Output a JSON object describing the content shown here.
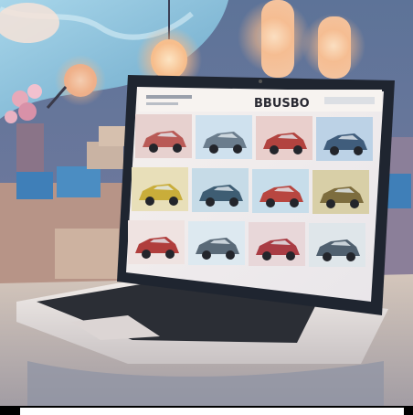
{
  "scene": {
    "description_label": "",
    "screen_header_text": "BBUSBO",
    "car_grid": {
      "rows": 4,
      "cols": 4,
      "cars": [
        {
          "color": "#b95a56",
          "bg": "#e7d1cf"
        },
        {
          "color": "#6b7d8d",
          "bg": "#cfe1ee"
        },
        {
          "color": "#b2433f",
          "bg": "#e9cfcc"
        },
        {
          "color": "#405d7c",
          "bg": "#bcd2e6"
        },
        {
          "color": "#c9ad3a",
          "bg": "#e8dfb9"
        },
        {
          "color": "#3e5d73",
          "bg": "#c6dbe7"
        },
        {
          "color": "#b84640",
          "bg": "#c7ddea"
        },
        {
          "color": "#7d6d3e",
          "bg": "#d8cfa7"
        },
        {
          "color": "#b03e3c",
          "bg": "#efe3e1"
        },
        {
          "color": "#5a6a78",
          "bg": "#dde9f0"
        },
        {
          "color": "#a93c44",
          "bg": "#e8d7d9"
        },
        {
          "color": "#50606f",
          "bg": "#dfe6ea"
        }
      ]
    },
    "colors": {
      "wall": "#6a7ea0",
      "sky": "#8fc2dc",
      "lamp_glow": "#f5b98c",
      "desk": "#d8c8b8",
      "laptop_body": "#e9e4e2",
      "bezel": "#1f2530",
      "keyboard": "#2b2e35",
      "bottom_bar": "#000000"
    }
  }
}
